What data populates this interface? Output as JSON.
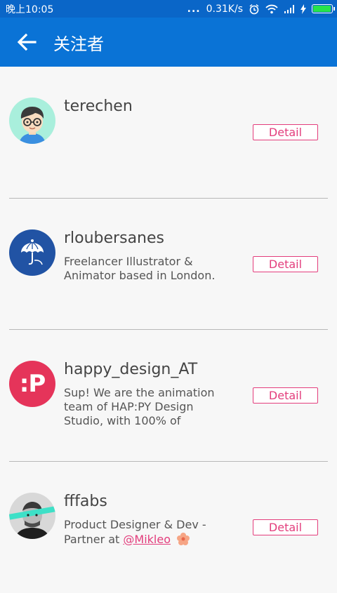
{
  "statusbar": {
    "time": "晚上10:05",
    "dots": "...",
    "speed": "0.31K/s"
  },
  "appbar": {
    "title": "关注者"
  },
  "colors": {
    "primary": "#0a73d6",
    "accent": "#e33d7c"
  },
  "followers": [
    {
      "name": "terechen",
      "description": "",
      "detail_label": "Detail",
      "avatar_icon": "cartoon-boy-avatar"
    },
    {
      "name": "rloubersanes",
      "description": "Freelancer Illustrator & Animator based in London.",
      "detail_label": "Detail",
      "avatar_icon": "umbrella-avatar"
    },
    {
      "name": "happy_design_AT",
      "description": "Sup! We are the animation team of HAP:PY Design Studio, with 100% of",
      "detail_label": "Detail",
      "avatar_icon": "p-logo-avatar",
      "avatar_text": ":P"
    },
    {
      "name": "fffabs",
      "description_prefix": "Product Designer & Dev - Partner at ",
      "mention": "@Mikleo",
      "detail_label": "Detail",
      "avatar_icon": "photo-avatar"
    }
  ]
}
